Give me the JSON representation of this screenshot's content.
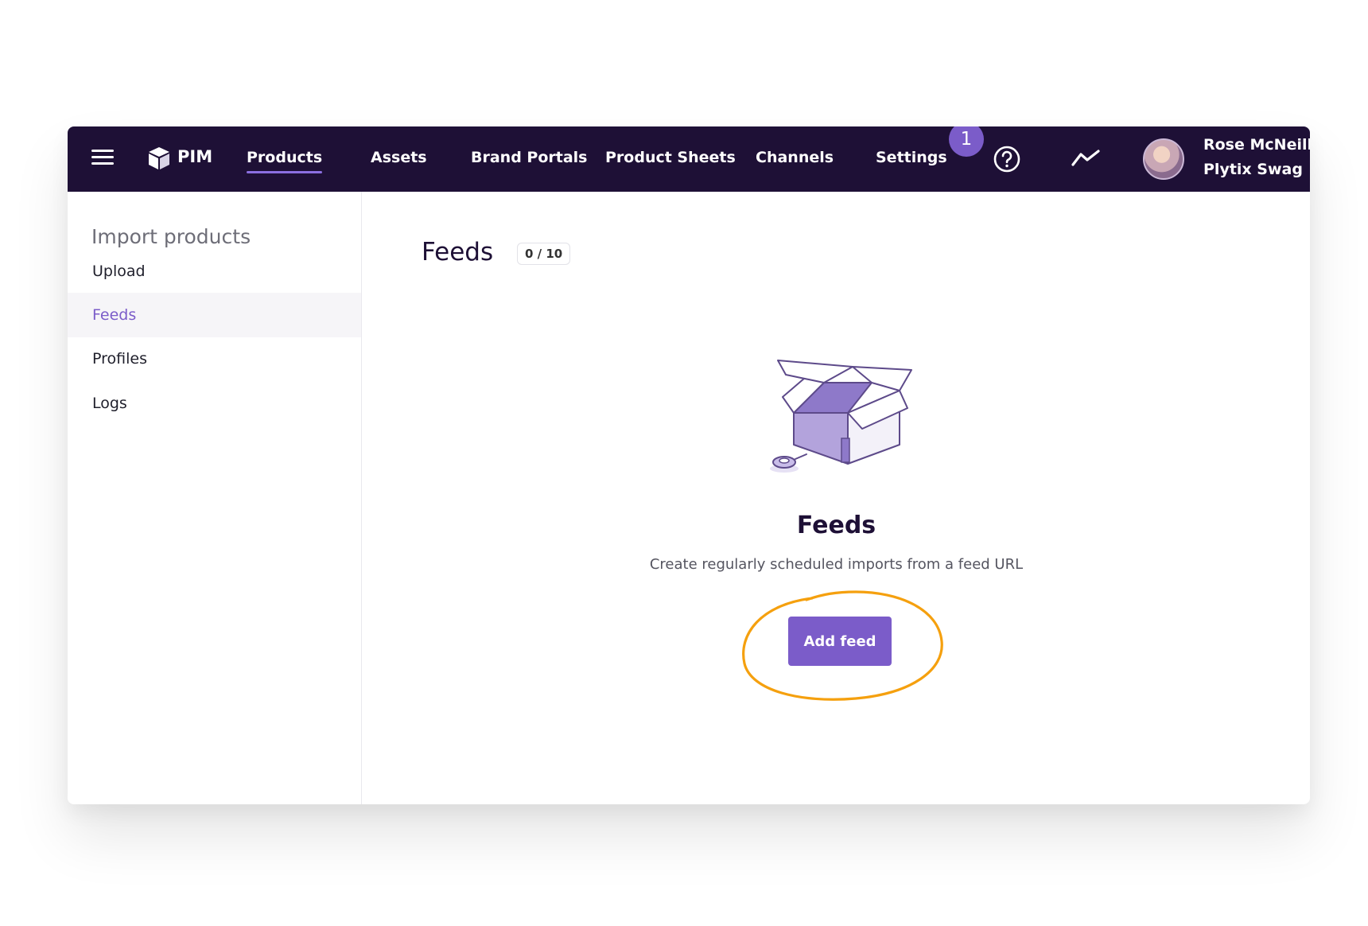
{
  "topbar": {
    "brand": "PIM",
    "nav": [
      {
        "label": "Products",
        "active": true
      },
      {
        "label": "Assets",
        "active": false
      },
      {
        "label": "Brand Portals",
        "active": false
      },
      {
        "label": "Product Sheets",
        "active": false
      },
      {
        "label": "Channels",
        "active": false
      },
      {
        "label": "Settings",
        "active": false
      }
    ],
    "notification_count": "1",
    "icons": {
      "menu": "hamburger-icon",
      "logo": "cube-icon",
      "help": "help-circle-icon",
      "analytics": "trend-line-icon"
    },
    "user": {
      "name": "Rose McNeill",
      "organization": "Plytix Swag"
    }
  },
  "sidebar": {
    "heading": "Import products",
    "items": [
      {
        "label": "Upload",
        "active": false
      },
      {
        "label": "Feeds",
        "active": true
      },
      {
        "label": "Profiles",
        "active": false
      },
      {
        "label": "Logs",
        "active": false
      }
    ]
  },
  "main": {
    "title": "Feeds",
    "count": "0 / 10",
    "empty_state": {
      "illustration": "open-box-icon",
      "title": "Feeds",
      "description": "Create regularly scheduled imports from a feed URL",
      "button_label": "Add feed"
    }
  },
  "colors": {
    "topbar_bg": "#1e1036",
    "accent": "#7b5cc9",
    "highlight": "#f5a00e"
  }
}
